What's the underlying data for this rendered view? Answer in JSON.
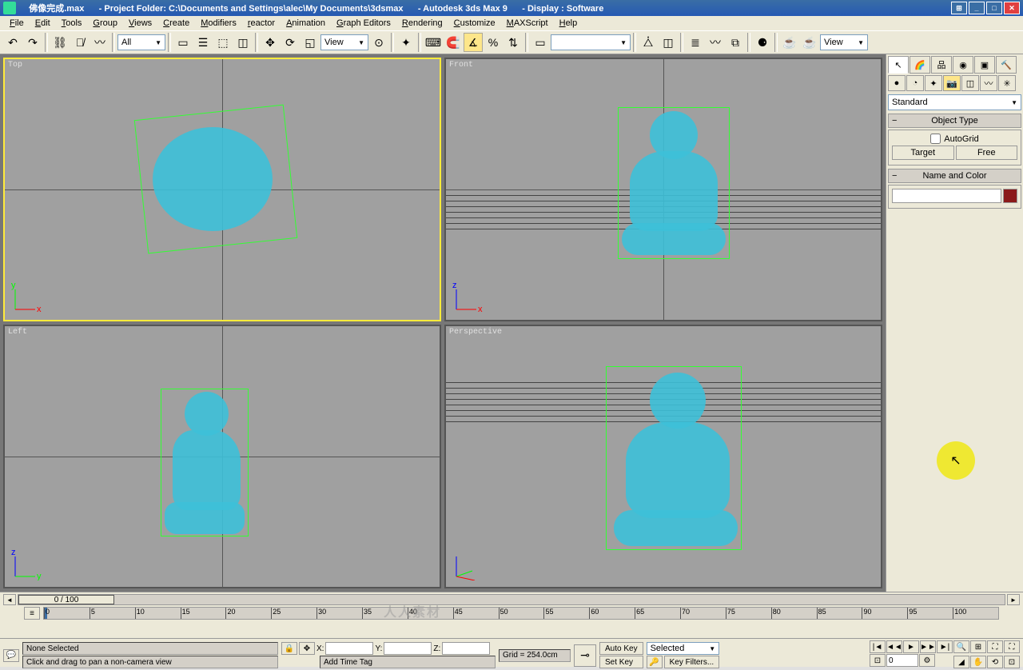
{
  "titlebar": {
    "file": "佛像完成.max",
    "folder": "- Project Folder: C:\\Documents and Settings\\alec\\My Documents\\3dsmax",
    "app": "- Autodesk 3ds Max 9",
    "display": "- Display : Software"
  },
  "menus": [
    "File",
    "Edit",
    "Tools",
    "Group",
    "Views",
    "Create",
    "Modifiers",
    "reactor",
    "Animation",
    "Graph Editors",
    "Rendering",
    "Customize",
    "MAXScript",
    "Help"
  ],
  "toolbar": {
    "combo_all": "All",
    "combo_view": "View",
    "combo_view2": "View"
  },
  "viewports": {
    "top": "Top",
    "front": "Front",
    "left": "Left",
    "perspective": "Perspective"
  },
  "command_panel": {
    "dropdown": "Standard",
    "object_type": "Object Type",
    "autogrid": "AutoGrid",
    "target": "Target",
    "free": "Free",
    "name_color": "Name and Color"
  },
  "timeline": {
    "frame_display": "0 / 100",
    "ticks": [
      "0",
      "5",
      "10",
      "15",
      "20",
      "25",
      "30",
      "35",
      "40",
      "45",
      "50",
      "55",
      "60",
      "65",
      "70",
      "75",
      "80",
      "85",
      "90",
      "95",
      "100"
    ]
  },
  "status": {
    "selection": "None Selected",
    "prompt": "Click and drag to pan a non-camera view",
    "x": "X:",
    "y": "Y:",
    "z": "Z:",
    "grid": "Grid = 254.0cm",
    "add_tag": "Add Time Tag",
    "auto_key": "Auto Key",
    "set_key": "Set Key",
    "selected": "Selected",
    "key_filters": "Key Filters...",
    "spinner": "0"
  },
  "watermark": "人人素材"
}
